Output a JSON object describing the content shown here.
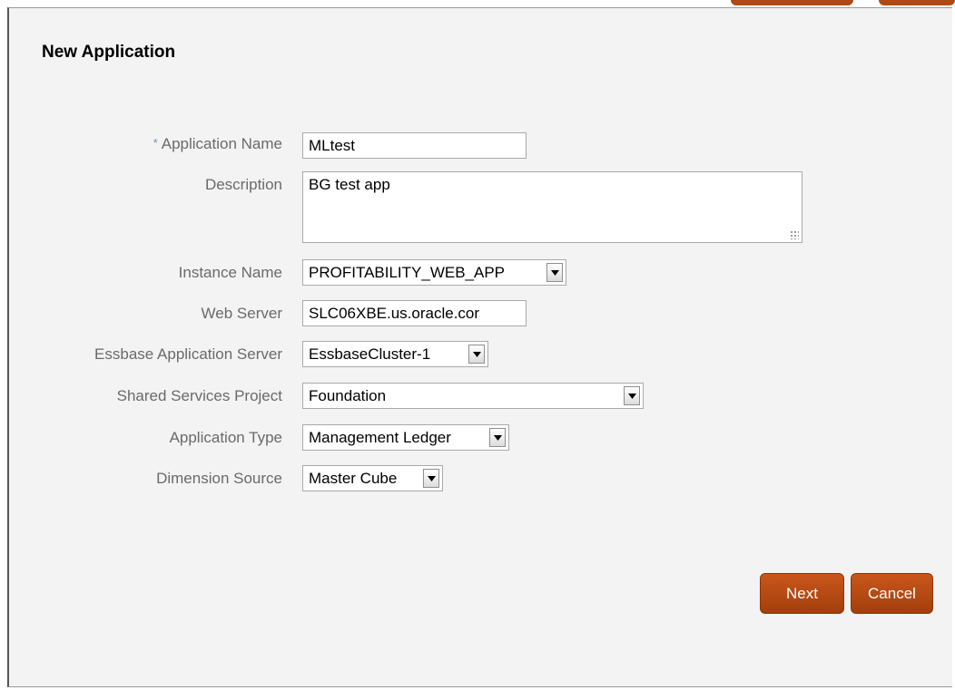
{
  "dialog": {
    "title": "New Application"
  },
  "form": {
    "required_marker": "*",
    "application_name": {
      "label": "Application Name",
      "value": "MLtest"
    },
    "description": {
      "label": "Description",
      "value": "BG test app"
    },
    "instance_name": {
      "label": "Instance Name",
      "value": "PROFITABILITY_WEB_APP"
    },
    "web_server": {
      "label": "Web Server",
      "value": "SLC06XBE.us.oracle.cor"
    },
    "essbase_server": {
      "label": "Essbase Application Server",
      "value": "EssbaseCluster-1"
    },
    "shared_services_project": {
      "label": "Shared Services Project",
      "value": "Foundation"
    },
    "application_type": {
      "label": "Application Type",
      "value": "Management Ledger"
    },
    "dimension_source": {
      "label": "Dimension Source",
      "value": "Master Cube"
    }
  },
  "buttons": {
    "next": "Next",
    "cancel": "Cancel"
  },
  "colors": {
    "button": "#b54a12",
    "label_text": "#6a6a6a",
    "panel_background": "#f3f3f3"
  },
  "icons": {
    "dropdown": "chevron-down-icon",
    "resize": "resize-grip-icon"
  }
}
